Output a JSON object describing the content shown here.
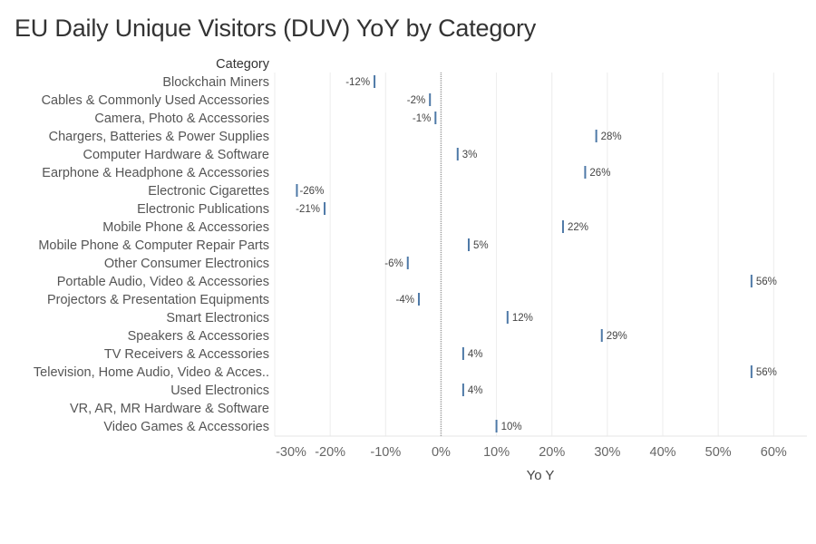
{
  "title": "EU Daily Unique Visitors (DUV) YoY by Category",
  "chart_data": {
    "type": "bar",
    "orientation": "horizontal",
    "mark": "tick",
    "title": "EU Daily Unique Visitors (DUV) YoY by Category",
    "row_header": "Category",
    "xlabel": "Yo Y",
    "ylabel": "Category",
    "xlim": [
      -30,
      66
    ],
    "x_ticks": [
      -30,
      -20,
      -10,
      0,
      10,
      20,
      30,
      40,
      50,
      60
    ],
    "x_tick_labels": [
      "-30%",
      "-20%",
      "-10%",
      "0%",
      "10%",
      "20%",
      "30%",
      "40%",
      "50%",
      "60%"
    ],
    "grid": true,
    "mark_color": "#4e79a7",
    "categories": [
      "Blockchain Miners",
      "Cables & Commonly Used Accessories",
      "Camera, Photo & Accessories",
      "Chargers, Batteries & Power Supplies",
      "Computer Hardware & Software",
      "Earphone & Headphone & Accessories",
      "Electronic Cigarettes",
      "Electronic Publications",
      "Mobile Phone & Accessories",
      "Mobile Phone & Computer Repair Parts",
      "Other Consumer Electronics",
      "Portable Audio, Video & Accessories",
      "Projectors & Presentation Equipments",
      "Smart Electronics",
      "Speakers & Accessories",
      "TV Receivers & Accessories",
      "Television, Home Audio, Video & Acces..",
      "Used Electronics",
      "VR, AR, MR Hardware & Software",
      "Video Games & Accessories"
    ],
    "values": [
      -12,
      -2,
      -1,
      28,
      3,
      26,
      -26,
      -21,
      22,
      5,
      -6,
      56,
      -4,
      12,
      29,
      4,
      56,
      4,
      null,
      10
    ],
    "value_labels": [
      "-12%",
      "-2%",
      "-1%",
      "28%",
      "3%",
      "26%",
      "-26%",
      "-21%",
      "22%",
      "5%",
      "-6%",
      "56%",
      "-4%",
      "12%",
      "29%",
      "4%",
      "56%",
      "4%",
      "",
      "10%"
    ]
  }
}
